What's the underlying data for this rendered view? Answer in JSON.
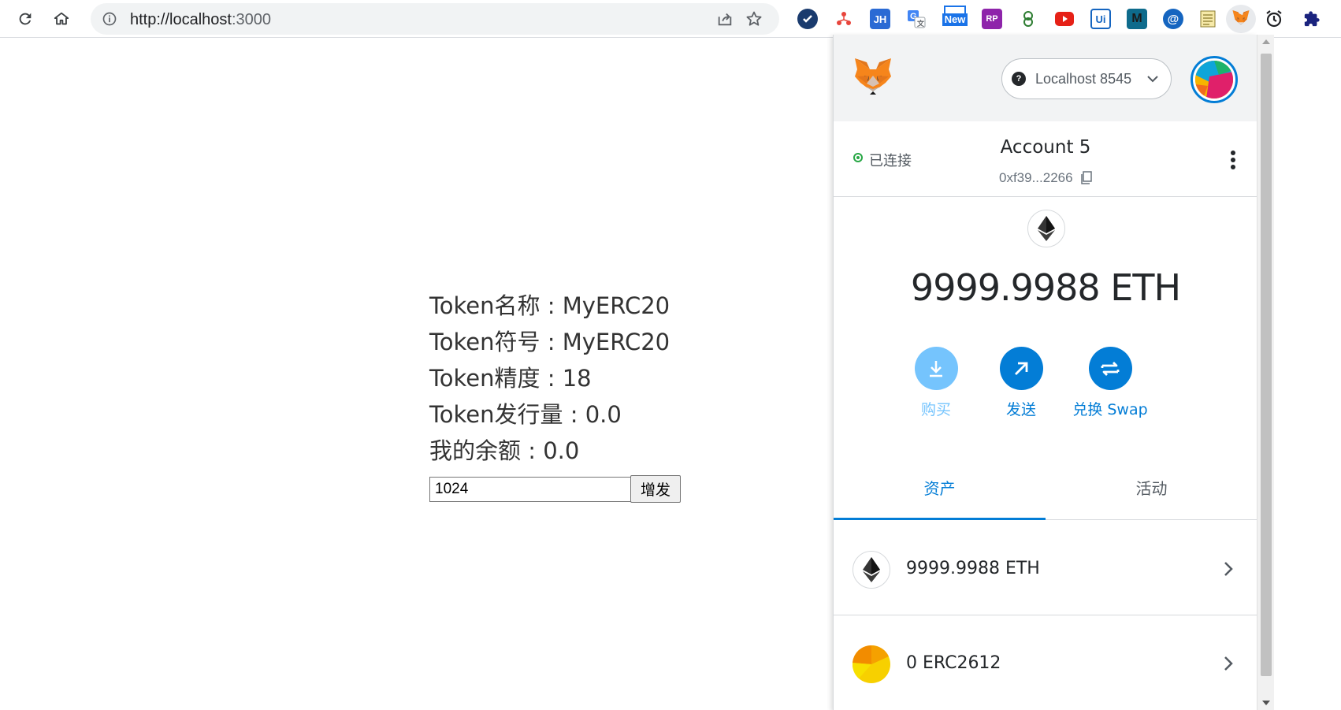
{
  "browser": {
    "url_host": "http://localhost",
    "url_port": ":3000",
    "extensions": [
      "check-icon",
      "network-icon",
      "JH",
      "translate-icon",
      "New",
      "RP",
      "brain-icon",
      "youtube-icon",
      "Ui",
      "M",
      "@",
      "notes-icon",
      "metamask-icon",
      "alarm-icon",
      "puzzle-icon"
    ],
    "ext_new_label": "New",
    "ext_jh": "JH",
    "ext_rp": "RP",
    "ext_ui": "Ui",
    "ext_m": "M",
    "ext_at": "@"
  },
  "page": {
    "rows": [
      {
        "label": "Token名称",
        "sep": " : ",
        "value": "MyERC20"
      },
      {
        "label": "Token符号",
        "sep": " : ",
        "value": "MyERC20"
      },
      {
        "label": "Token精度",
        "sep": " : ",
        "value": "18"
      },
      {
        "label": "Token发行量",
        "sep": " : ",
        "value": "0.0"
      },
      {
        "label": "我的余额",
        "sep": " : ",
        "value": "0.0"
      }
    ],
    "mint_value": "1024",
    "mint_button": "增发"
  },
  "metamask": {
    "network": "Localhost 8545",
    "network_icon_letter": "?",
    "connected_label": "已连接",
    "account_name": "Account 5",
    "account_address": "0xf39...2266",
    "balance": "9999.9988 ETH",
    "actions": [
      {
        "label": "购买",
        "icon": "download-icon",
        "color": "#75c4fd",
        "text_color": "#75c4fd"
      },
      {
        "label": "发送",
        "icon": "arrow-up-right-icon",
        "color": "#037dd6",
        "text_color": "#037dd6"
      },
      {
        "label": "兑换 Swap",
        "icon": "swap-icon",
        "color": "#037dd6",
        "text_color": "#037dd6"
      }
    ],
    "tabs": [
      {
        "label": "资产",
        "active": true
      },
      {
        "label": "活动",
        "active": false
      }
    ],
    "assets": [
      {
        "label": "9999.9988 ETH",
        "icon": "eth-icon"
      },
      {
        "label": "0 ERC2612",
        "icon": "token-icon"
      }
    ],
    "accent_color": "#037dd6"
  }
}
